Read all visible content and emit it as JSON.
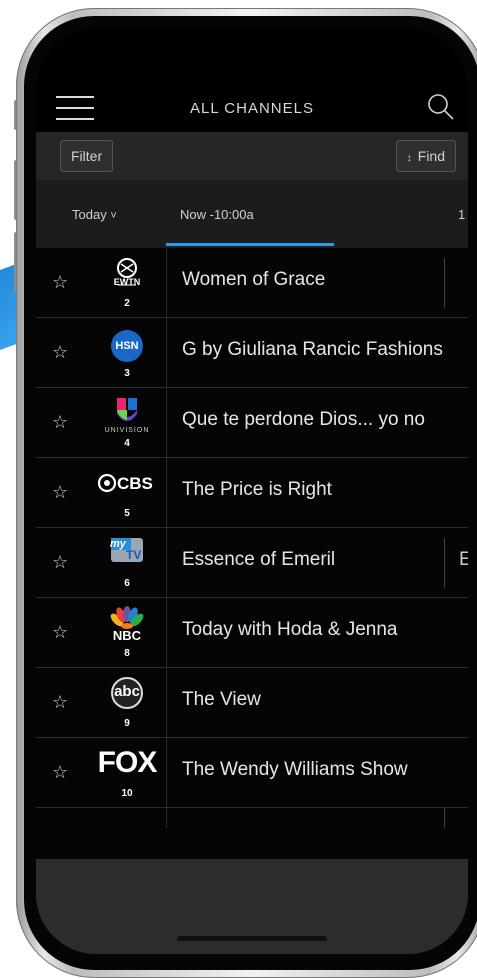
{
  "header": {
    "title": "ALL CHANNELS"
  },
  "toolbar": {
    "filter_label": "Filter",
    "find_label": "Find",
    "find_icon": "↕"
  },
  "timebar": {
    "day_label": "Today",
    "day_chevron": "˅",
    "now_label": "Now -10:00a",
    "next_label": "1"
  },
  "colors": {
    "accent": "#2f9be8",
    "background": "#050505",
    "toolbar": "#262628"
  },
  "channels": [
    {
      "logo_text": "EWTN",
      "number": "2",
      "program": "Women of Grace",
      "next_program_peek": ""
    },
    {
      "logo_text": "HSN",
      "number": "3",
      "program": "G by Giuliana Rancic Fashions",
      "next_program_peek": ""
    },
    {
      "logo_text": "UNIVISION",
      "number": "4",
      "program": "Que te perdone Dios... yo no",
      "next_program_peek": ""
    },
    {
      "logo_text": "CBS",
      "number": "5",
      "program": "The Price is Right",
      "next_program_peek": ""
    },
    {
      "logo_text": "my",
      "logo_text_2": "TV",
      "number": "6",
      "program": "Essence of Emeril",
      "next_program_peek": "E"
    },
    {
      "logo_text": "NBC",
      "number": "8",
      "program": "Today with Hoda & Jenna",
      "next_program_peek": ""
    },
    {
      "logo_text": "abc",
      "number": "9",
      "program": "The View",
      "next_program_peek": ""
    },
    {
      "logo_text": "FOX",
      "number": "10",
      "program": "The Wendy Williams Show",
      "next_program_peek": ""
    }
  ],
  "star_glyph": "☆"
}
